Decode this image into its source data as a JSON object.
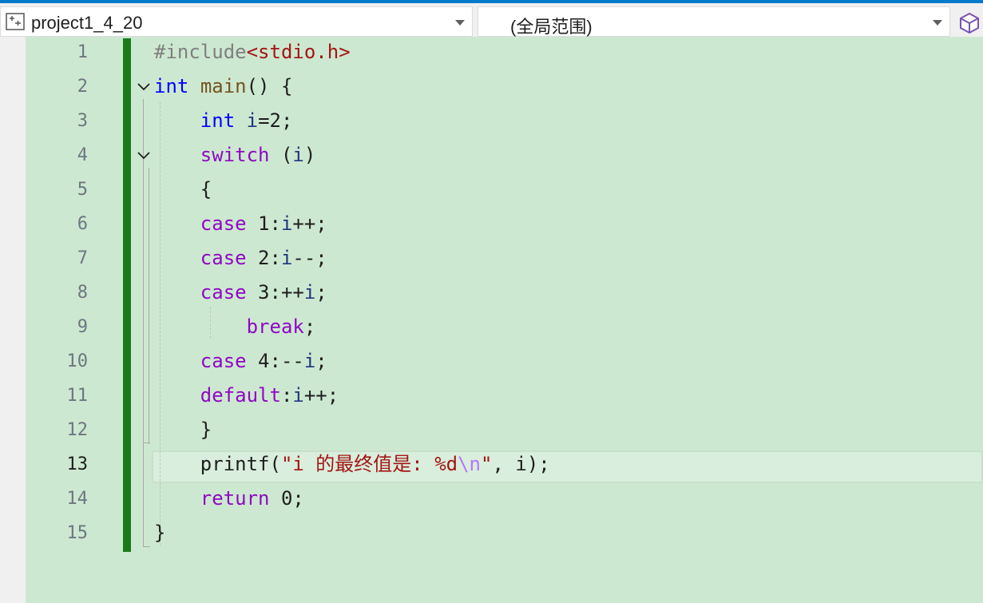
{
  "navbar": {
    "project_combo": "project1_4_20",
    "scope_combo": "(全局范围)"
  },
  "icons": {
    "project": "project-icon",
    "dropdown": "chevron-down-icon",
    "member": "cube-icon",
    "fold": "fold-chevron-icon"
  },
  "colors": {
    "accent": "#007acc",
    "editor_bg": "#cde8d0",
    "change_bar": "#1a7a1a",
    "keyword": "#0000ff",
    "control_keyword": "#8f08c4",
    "string": "#a31515",
    "escape": "#b776fb"
  },
  "editor": {
    "current_line": 13,
    "line_numbers": [
      "1",
      "2",
      "3",
      "4",
      "5",
      "6",
      "7",
      "8",
      "9",
      "10",
      "11",
      "12",
      "13",
      "14",
      "15"
    ],
    "lines": [
      [
        {
          "t": "#include",
          "c": "pp"
        },
        {
          "t": "<stdio.h>",
          "c": "inc"
        }
      ],
      [
        {
          "t": "int",
          "c": "kw"
        },
        {
          "t": " ",
          "c": ""
        },
        {
          "t": "main",
          "c": "fn"
        },
        {
          "t": "() {",
          "c": ""
        }
      ],
      [
        {
          "t": "    ",
          "c": ""
        },
        {
          "t": "int",
          "c": "kw"
        },
        {
          "t": " ",
          "c": ""
        },
        {
          "t": "i",
          "c": "var"
        },
        {
          "t": "=2;",
          "c": ""
        }
      ],
      [
        {
          "t": "    ",
          "c": ""
        },
        {
          "t": "switch",
          "c": "kw2"
        },
        {
          "t": " (",
          "c": ""
        },
        {
          "t": "i",
          "c": "var"
        },
        {
          "t": ")",
          "c": ""
        }
      ],
      [
        {
          "t": "    {",
          "c": ""
        }
      ],
      [
        {
          "t": "    ",
          "c": ""
        },
        {
          "t": "case",
          "c": "kw2"
        },
        {
          "t": " 1:",
          "c": ""
        },
        {
          "t": "i",
          "c": "var"
        },
        {
          "t": "++;",
          "c": ""
        }
      ],
      [
        {
          "t": "    ",
          "c": ""
        },
        {
          "t": "case",
          "c": "kw2"
        },
        {
          "t": " 2:",
          "c": ""
        },
        {
          "t": "i",
          "c": "var"
        },
        {
          "t": "--;",
          "c": ""
        }
      ],
      [
        {
          "t": "    ",
          "c": ""
        },
        {
          "t": "case",
          "c": "kw2"
        },
        {
          "t": " 3:++",
          "c": ""
        },
        {
          "t": "i",
          "c": "var"
        },
        {
          "t": ";",
          "c": ""
        }
      ],
      [
        {
          "t": "        ",
          "c": ""
        },
        {
          "t": "break",
          "c": "kw2"
        },
        {
          "t": ";",
          "c": ""
        }
      ],
      [
        {
          "t": "    ",
          "c": ""
        },
        {
          "t": "case",
          "c": "kw2"
        },
        {
          "t": " 4:--",
          "c": ""
        },
        {
          "t": "i",
          "c": "var"
        },
        {
          "t": ";",
          "c": ""
        }
      ],
      [
        {
          "t": "    ",
          "c": ""
        },
        {
          "t": "default",
          "c": "kw2"
        },
        {
          "t": ":",
          "c": ""
        },
        {
          "t": "i",
          "c": "var"
        },
        {
          "t": "++;",
          "c": ""
        }
      ],
      [
        {
          "t": "    }",
          "c": ""
        }
      ],
      [
        {
          "t": "    printf(",
          "c": ""
        },
        {
          "t": "\"i 的最终值是: %d",
          "c": "str"
        },
        {
          "t": "\\n",
          "c": "esc"
        },
        {
          "t": "\"",
          "c": "str"
        },
        {
          "t": ", i);",
          "c": ""
        }
      ],
      [
        {
          "t": "    ",
          "c": ""
        },
        {
          "t": "return",
          "c": "kw2"
        },
        {
          "t": " 0;",
          "c": ""
        }
      ],
      [
        {
          "t": "}",
          "c": ""
        }
      ]
    ]
  }
}
